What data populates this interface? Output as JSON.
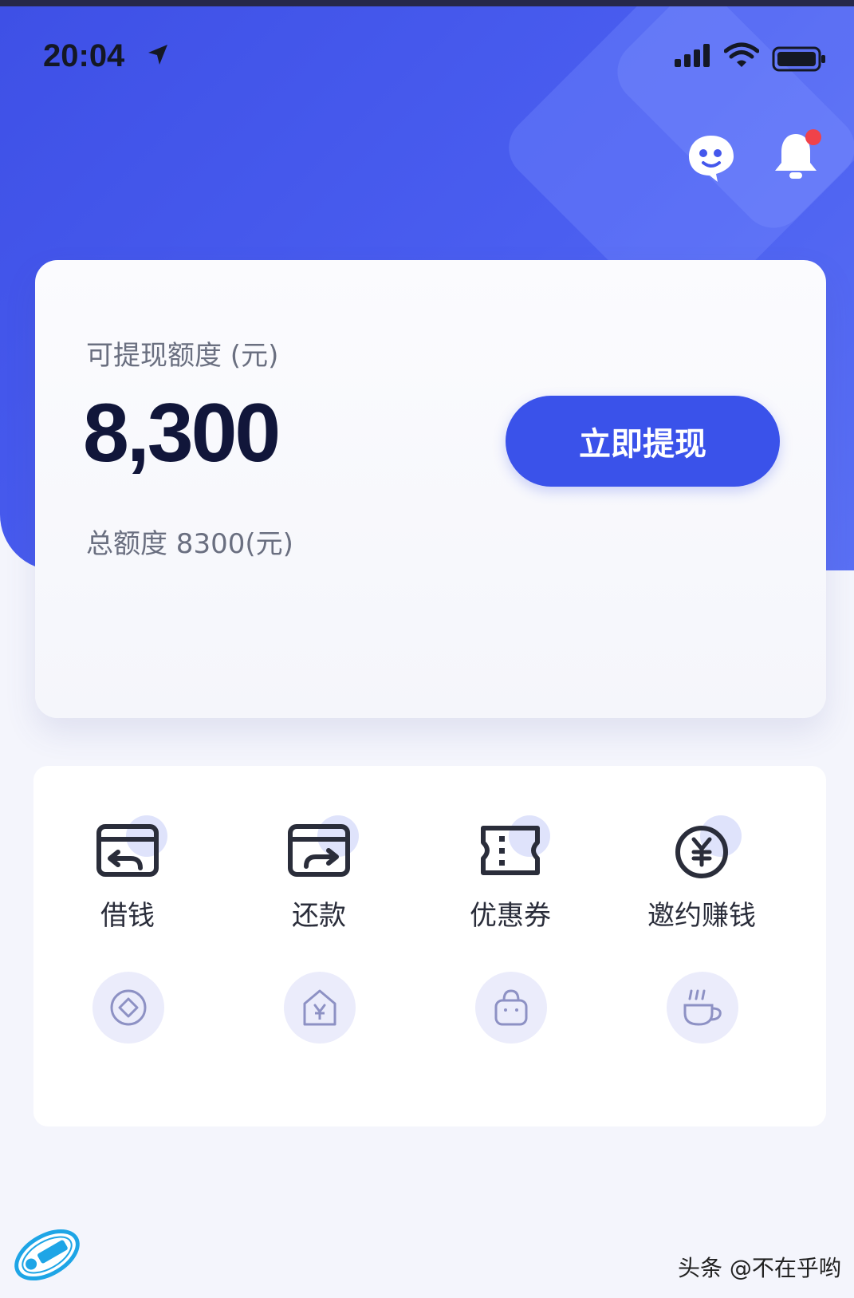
{
  "status_bar": {
    "time": "20:04"
  },
  "card": {
    "label": "可提现额度 (元)",
    "amount": "8,300",
    "total": "总额度 8300(元)",
    "withdraw_button": "立即提现"
  },
  "actions": [
    {
      "label": "借钱",
      "icon": "borrow-icon"
    },
    {
      "label": "还款",
      "icon": "repay-icon"
    },
    {
      "label": "优惠券",
      "icon": "coupon-icon"
    },
    {
      "label": "邀约赚钱",
      "icon": "invite-earn-icon"
    }
  ],
  "secondary_icons": [
    "diamond-icon",
    "yuan-tag-icon",
    "bag-icon",
    "coffee-icon"
  ],
  "watermark": "头条 @不在乎哟",
  "colors": {
    "accent": "#3a52ea",
    "hero": "#4457ec",
    "notification_dot": "#f0424a"
  }
}
